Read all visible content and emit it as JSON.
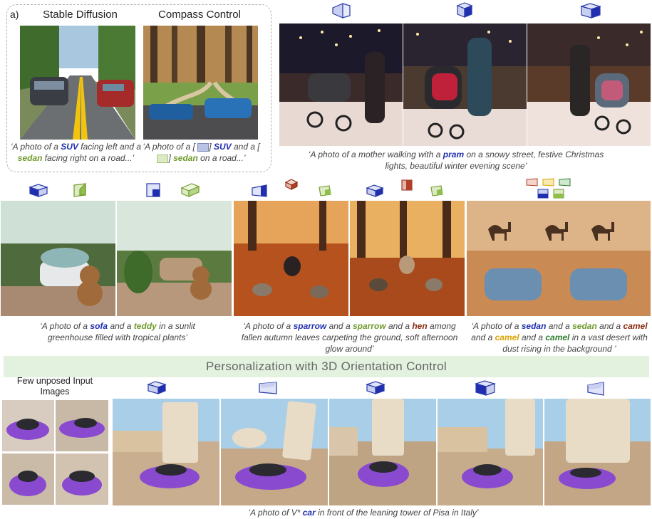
{
  "panel_a": {
    "label": "a)",
    "header_left": "Stable Diffusion",
    "header_right": "Compass Control",
    "caption_left": {
      "p1": "‘A  photo of a ",
      "k1": "SUV",
      "p2": " facing left and a ",
      "k2": "sedan",
      "p3": " facing right on a road...’"
    },
    "caption_right": {
      "p1": "‘A photo of a [ ",
      "p2": "] ",
      "k1": "SUV",
      "p3": " and a [ ",
      "p4": "] ",
      "k2": "sedan",
      "p5": " on a road...’"
    }
  },
  "pram": {
    "p1": "‘A photo of a mother walking with a ",
    "k1": "pram",
    "p2": " on a snowy street, festive Christmas lights, beautiful winter evening scene’"
  },
  "sofa": {
    "p1": "‘A photo of a ",
    "k1": "sofa",
    "p2": " and a ",
    "k2": "teddy",
    "p3": " in a sunlit greenhouse filled with tropical plants’"
  },
  "birds": {
    "p1": "‘A photo of a ",
    "k1": "sparrow",
    "p2": " and a ",
    "k2": "sparrow",
    "p3": " and a ",
    "k3": "hen",
    "p4": " among fallen autumn leaves carpeting the ground, soft afternoon glow around’"
  },
  "desert": {
    "p1": "‘A photo of a ",
    "k1": "sedan",
    "p2": " and a ",
    "k2": "sedan",
    "p3": " and a ",
    "k3": "camel",
    "p4": " and a ",
    "k4": "camel",
    "p5": " and a ",
    "k5": "camel",
    "p6": " in a vast desert with dust rising in the background ’"
  },
  "banner": "Personalization with 3D Orientation Control",
  "few_label": "Few unposed Input Images",
  "pisa": {
    "p1": "‘A photo of V* ",
    "k1": "car",
    "p2": " in front of the leaning tower of Pisa in Italy’"
  },
  "colors": {
    "blue": "#1f2fb0",
    "green": "#6f9a2a",
    "brown": "#8a2a10",
    "yellow": "#d9a400",
    "banner": "#e3f1df"
  }
}
